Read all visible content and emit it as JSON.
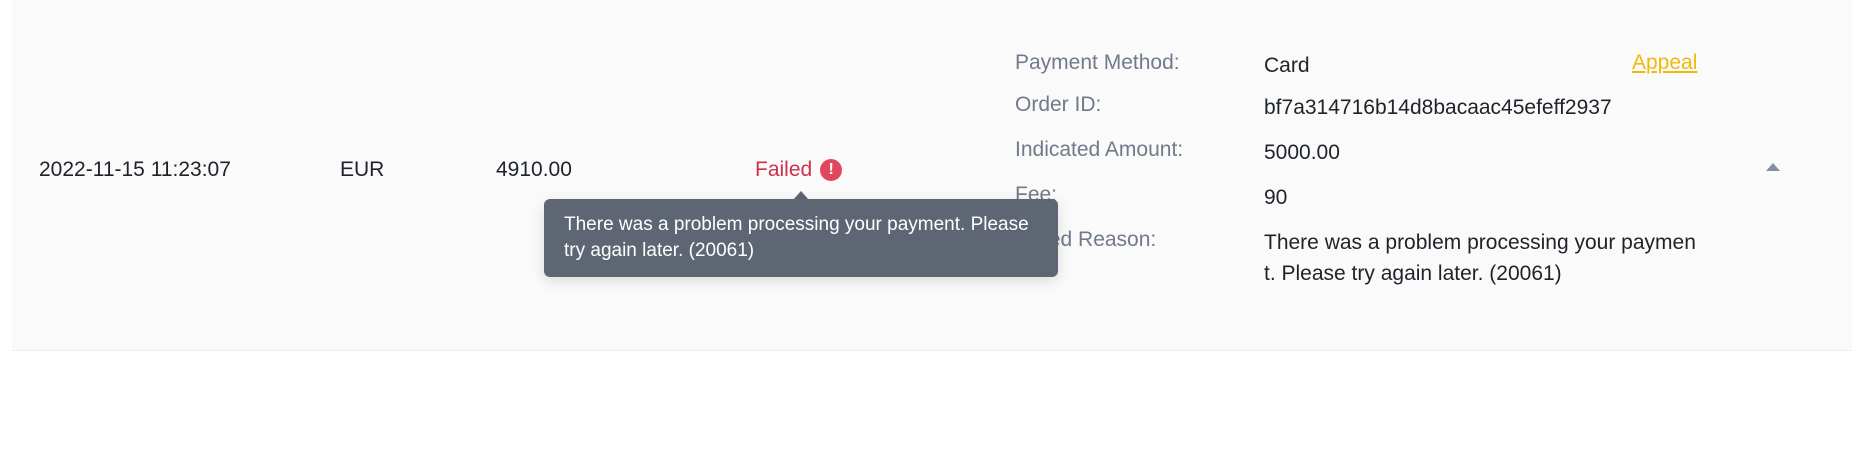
{
  "transaction": {
    "date": "2022-11-15 11:23:07",
    "currency": "EUR",
    "amount": "4910.00",
    "status": "Failed",
    "status_icon": "exclamation-icon",
    "status_color": "#cf304a"
  },
  "tooltip": {
    "text": "There was a problem processing your payment. Please try again later. (20061)"
  },
  "details": {
    "payment_method_label": "Payment Method:",
    "payment_method_value": "Card",
    "order_id_label": "Order ID:",
    "order_id_value": "bf7a314716b14d8bacaac45efeff2937",
    "indicated_amount_label": "Indicated Amount:",
    "indicated_amount_value": "5000.00",
    "fee_label": "Fee:",
    "fee_value": "90",
    "failed_reason_label": "Failed Reason:",
    "failed_reason_value": "There was a problem processing your payment. Please try again later. (20061)"
  },
  "actions": {
    "appeal_label": "Appeal",
    "appeal_color": "#f0b90b",
    "collapse_icon": "caret-up-icon"
  }
}
